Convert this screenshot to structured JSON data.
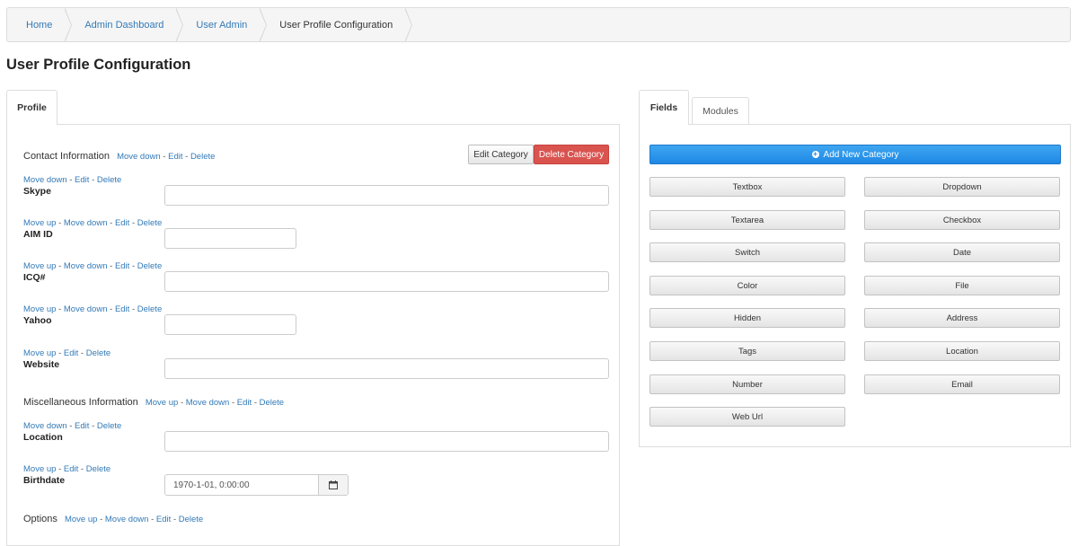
{
  "breadcrumb": [
    "Home",
    "Admin Dashboard",
    "User Admin",
    "User Profile Configuration"
  ],
  "page_title": "User Profile Configuration",
  "left_tabs": {
    "profile": "Profile"
  },
  "right_tabs": {
    "fields": "Fields",
    "modules": "Modules"
  },
  "links": {
    "move_up": "Move up",
    "move_down": "Move down",
    "edit": "Edit",
    "delete": "Delete",
    "sep": "-"
  },
  "buttons": {
    "edit_category": "Edit Category",
    "delete_category": "Delete Category",
    "add_new_category": "Add New Category"
  },
  "categories": {
    "contact": "Contact Information",
    "misc": "Miscellaneous Information",
    "options": "Options"
  },
  "fields": {
    "skype": "Skype",
    "aim": "AIM ID",
    "icq": "ICQ#",
    "yahoo": "Yahoo",
    "website": "Website",
    "location": "Location",
    "birthdate": "Birthdate",
    "birthdate_value": "1970-1-01, 0:00:00"
  },
  "field_types": [
    "Textbox",
    "Dropdown",
    "Textarea",
    "Checkbox",
    "Switch",
    "Date",
    "Color",
    "File",
    "Hidden",
    "Address",
    "Tags",
    "Location",
    "Number",
    "Email",
    "Web Url"
  ],
  "icons": {
    "add": "plus-circle-icon",
    "calendar": "calendar-icon"
  },
  "colors": {
    "link": "#337ab7",
    "danger": "#d9534f",
    "primary": "#2196f3"
  }
}
